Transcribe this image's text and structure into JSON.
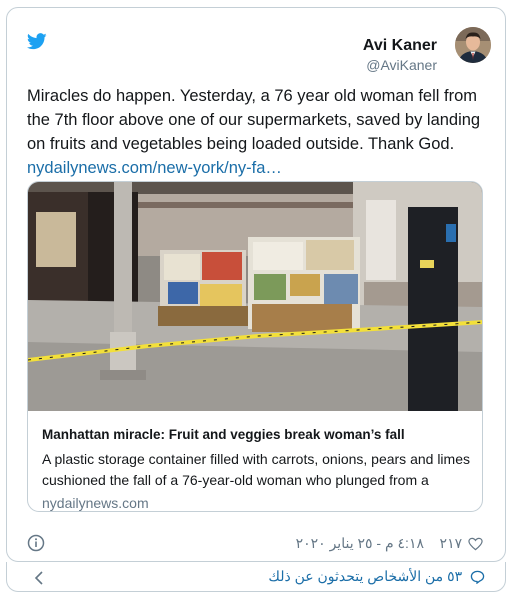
{
  "author": {
    "name": "Avi Kaner",
    "handle": "@AviKaner"
  },
  "tweet": {
    "text": "Miracles do happen. Yesterday, a 76 year old woman fell from the 7th floor above one of our supermarkets, saved by landing on fruits and vegetables being loaded outside. Thank God.",
    "link": "nydailynews.com/new-york/ny-fa…"
  },
  "link_card": {
    "title": "Manhattan miracle: Fruit and veggies break woman’s fall",
    "description": "A plastic storage container filled with carrots, onions, pears and limes cushioned the fall of a 76-year-old woman who plunged from a",
    "domain": "nydailynews.com"
  },
  "footer": {
    "likes": "٢١٧",
    "timestamp": "٤:١٨ م - ٢٥ يناير ٢٠٢٠"
  },
  "conversation": {
    "label": "٥٣ من الأشخاص يتحدثون عن ذلك"
  },
  "icons": {
    "brand": "twitter-bird-icon",
    "info": "info-icon",
    "like": "heart-icon",
    "reply": "speech-bubble-icon",
    "back": "chevron-left-icon"
  },
  "colors": {
    "brand_blue": "#1da1f2",
    "link": "#1b6ea8",
    "muted": "#657786",
    "border": "#c4cfd6"
  }
}
